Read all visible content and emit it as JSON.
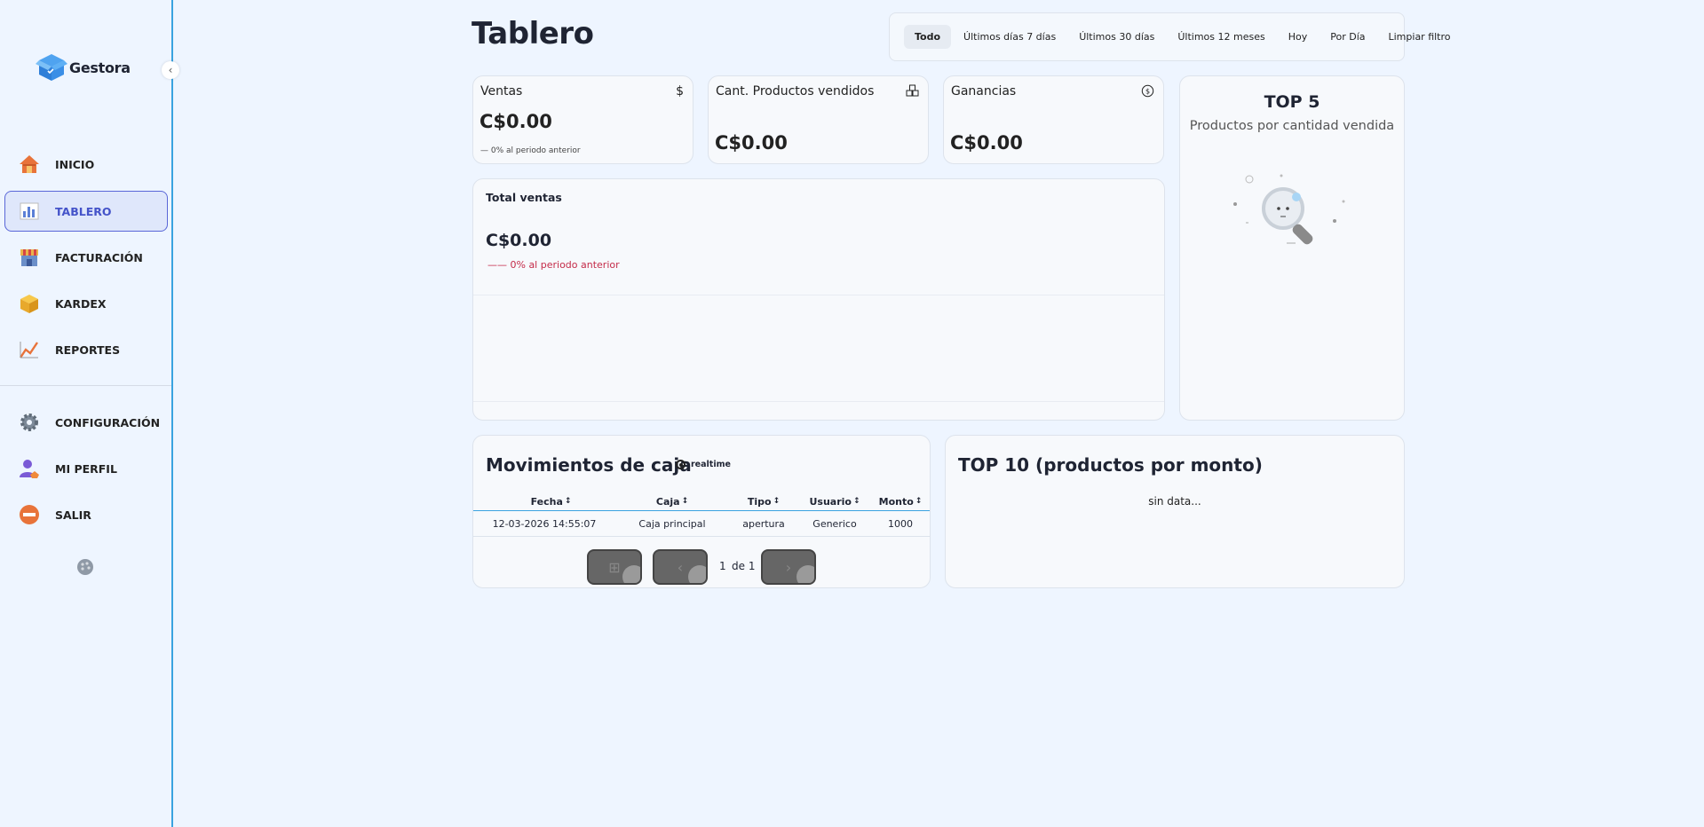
{
  "brand": {
    "name": "Gestora",
    "logo_icon": "box-logo-icon",
    "accent": "#3a8ee6"
  },
  "sidebar": {
    "items": [
      {
        "label": "INICIO",
        "icon": "house-icon",
        "active": false
      },
      {
        "label": "TABLERO",
        "icon": "bar-chart-icon",
        "active": true
      },
      {
        "label": "FACTURACIÓN",
        "icon": "store-icon",
        "active": false
      },
      {
        "label": "KARDEX",
        "icon": "box-icon",
        "active": false
      },
      {
        "label": "REPORTES",
        "icon": "line-chart-icon",
        "active": false
      },
      {
        "label": "CONFIGURACIÓN",
        "icon": "gear-icon",
        "active": false
      },
      {
        "label": "MI PERFIL",
        "icon": "user-icon",
        "active": false
      },
      {
        "label": "SALIR",
        "icon": "exit-icon",
        "active": false
      }
    ],
    "active_color": "#4453c9"
  },
  "page": {
    "title": "Tablero"
  },
  "filters": {
    "options": [
      "Todo",
      "Últimos días 7 días",
      "Últimos 30 días",
      "Últimos 12 meses",
      "Hoy",
      "Por Día",
      "Limpiar filtro"
    ],
    "selected": "Todo"
  },
  "stats": {
    "ventas": {
      "label": "Ventas",
      "icon": "dollar-icon",
      "value": "C$0.00",
      "delta": "— 0% al periodo anterior"
    },
    "productos": {
      "label": "Cant. Productos vendidos",
      "icon": "boxes-icon",
      "value": "C$0.00"
    },
    "ganancias": {
      "label": "Ganancias",
      "icon": "coin-cycle-icon",
      "value": "C$0.00"
    }
  },
  "total_ventas": {
    "label": "Total ventas",
    "value": "C$0.00",
    "delta": "—— 0% al periodo anterior",
    "delta_color": "#c42b49"
  },
  "top5": {
    "title": "TOP 5",
    "subtitle": "Productos por cantidad vendida",
    "empty_icon": "magnifier-empty-icon"
  },
  "movimientos": {
    "title": "Movimientos de caja",
    "realtime_label": "realtime",
    "columns": [
      "Fecha",
      "Caja",
      "Tipo",
      "Usuario",
      "Monto"
    ],
    "rows": [
      {
        "fecha": "12-03-2026 14:55:07",
        "caja": "Caja principal",
        "tipo": "apertura",
        "usuario": "Generico",
        "monto": "1000"
      }
    ],
    "pager": {
      "page": "1",
      "of_label": "de 1"
    }
  },
  "top10": {
    "title": "TOP 10 (productos por monto)",
    "empty_text": "sin data..."
  }
}
